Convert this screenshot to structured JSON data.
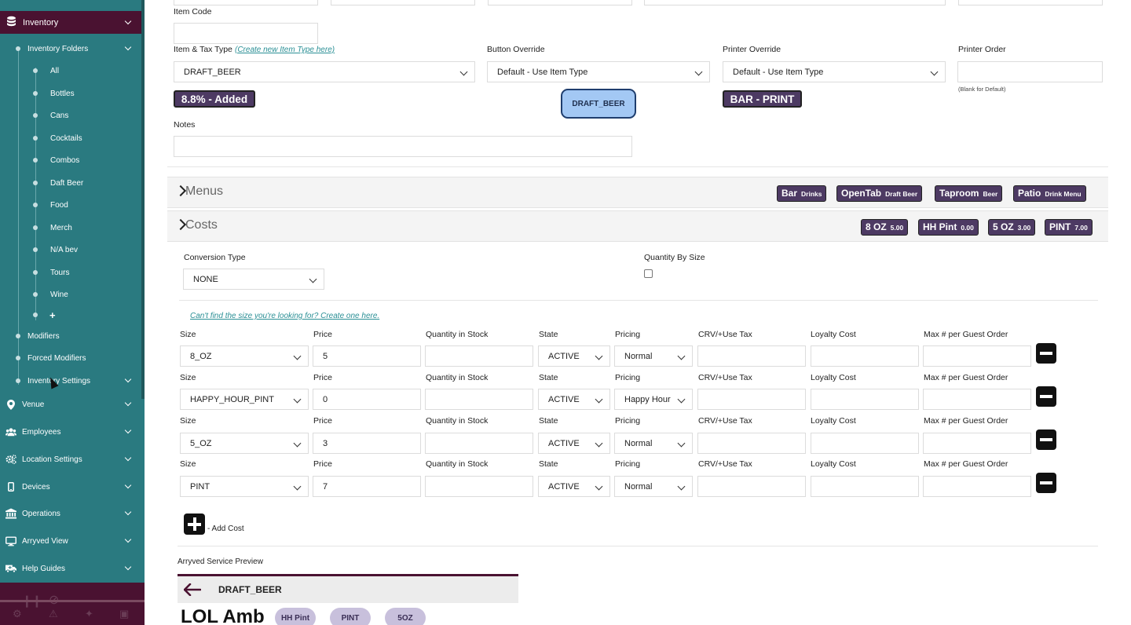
{
  "sidebar": {
    "inventory_label": "Inventory",
    "folders_label": "Inventory Folders",
    "folders": [
      "All",
      "Bottles",
      "Cans",
      "Cocktails",
      "Combos",
      "Daft Beer",
      "Food",
      "Merch",
      "N/A bev",
      "Tours",
      "Wine"
    ],
    "add_folder_label": "+",
    "modifiers_label": "Modifiers",
    "forced_modifiers_label": "Forced Modifiers",
    "inventory_settings_label": "Inventory Settings",
    "sections": [
      {
        "label": "Venue",
        "icon": "map-pin-icon"
      },
      {
        "label": "Employees",
        "icon": "users-icon"
      },
      {
        "label": "Location Settings",
        "icon": "gears-icon"
      },
      {
        "label": "Devices",
        "icon": "mobile-icon"
      },
      {
        "label": "Operations",
        "icon": "bank-icon"
      },
      {
        "label": "Arryved View",
        "icon": "monitor-icon"
      },
      {
        "label": "Help Guides",
        "icon": "ambulance-icon"
      }
    ]
  },
  "form": {
    "item_code_label": "Item Code",
    "item_tax_type_label": "Item & Tax Type",
    "create_item_type_link": "(Create new Item Type here)",
    "item_tax_type_value": "DRAFT_BEER",
    "tax_badge": "8.8% - Added",
    "button_override_label": "Button Override",
    "button_override_value": "Default - Use Item Type",
    "button_preview": "DRAFT_BEER",
    "printer_override_label": "Printer Override",
    "printer_override_value": "Default - Use Item Type",
    "printer_badge": "BAR - PRINT",
    "printer_order_label": "Printer Order",
    "printer_order_note": "(Blank for Default)",
    "notes_label": "Notes"
  },
  "menus": {
    "title": "Menus",
    "badges": [
      {
        "main": "Bar",
        "sub": "Drinks"
      },
      {
        "main": "OpenTab",
        "sub": "Draft Beer"
      },
      {
        "main": "Taproom",
        "sub": "Beer"
      },
      {
        "main": "Patio",
        "sub": "Drink Menu"
      }
    ]
  },
  "costs": {
    "title": "Costs",
    "badges": [
      {
        "main": "8 OZ",
        "sub": "5.00"
      },
      {
        "main": "HH Pint",
        "sub": "0.00"
      },
      {
        "main": "5 OZ",
        "sub": "3.00"
      },
      {
        "main": "PINT",
        "sub": "7.00"
      }
    ],
    "conversion_type_label": "Conversion Type",
    "conversion_type_value": "NONE",
    "quantity_by_size_label": "Quantity By Size",
    "size_link": "Can't find the size you're looking for? Create one here.",
    "headers": {
      "size": "Size",
      "price": "Price",
      "qty": "Quantity in Stock",
      "state": "State",
      "pricing": "Pricing",
      "crv": "CRV/+Use Tax",
      "loyalty": "Loyalty Cost",
      "max": "Max # per Guest Order"
    },
    "rows": [
      {
        "size": "8_OZ",
        "price": "5",
        "state": "ACTIVE",
        "pricing": "Normal"
      },
      {
        "size": "HAPPY_HOUR_PINT",
        "price": "0",
        "state": "ACTIVE",
        "pricing": "Happy Hour"
      },
      {
        "size": "5_OZ",
        "price": "3",
        "state": "ACTIVE",
        "pricing": "Normal"
      },
      {
        "size": "PINT",
        "price": "7",
        "state": "ACTIVE",
        "pricing": "Normal"
      }
    ],
    "add_cost_label": "- Add Cost"
  },
  "preview": {
    "label": "Arryved Service Preview",
    "title": "DRAFT_BEER",
    "item_name": "LOL Amb",
    "pills": [
      "HH Pint",
      "PINT",
      "5OZ"
    ]
  },
  "colors": {
    "sidebar": "#2a7a80",
    "sidebar_active": "#4a1231",
    "badge": "#4d3a63",
    "link": "#2a8f95"
  }
}
